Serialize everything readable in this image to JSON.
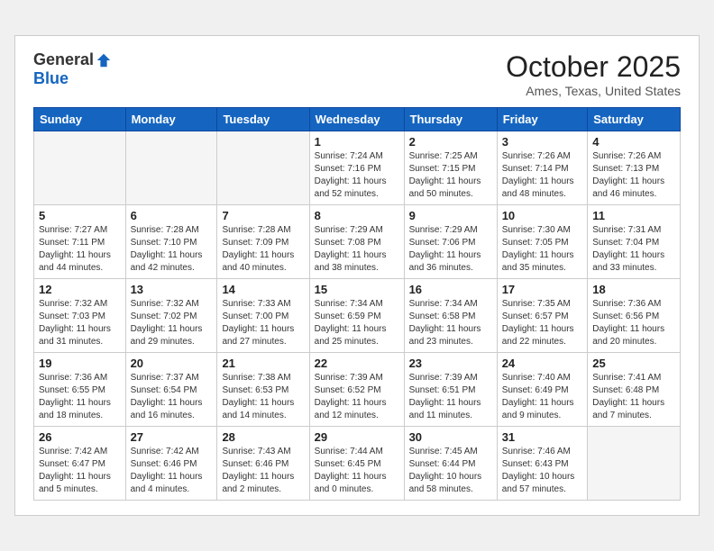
{
  "header": {
    "logo_general": "General",
    "logo_blue": "Blue",
    "month": "October 2025",
    "location": "Ames, Texas, United States"
  },
  "weekdays": [
    "Sunday",
    "Monday",
    "Tuesday",
    "Wednesday",
    "Thursday",
    "Friday",
    "Saturday"
  ],
  "weeks": [
    [
      {
        "day": "",
        "info": ""
      },
      {
        "day": "",
        "info": ""
      },
      {
        "day": "",
        "info": ""
      },
      {
        "day": "1",
        "info": "Sunrise: 7:24 AM\nSunset: 7:16 PM\nDaylight: 11 hours\nand 52 minutes."
      },
      {
        "day": "2",
        "info": "Sunrise: 7:25 AM\nSunset: 7:15 PM\nDaylight: 11 hours\nand 50 minutes."
      },
      {
        "day": "3",
        "info": "Sunrise: 7:26 AM\nSunset: 7:14 PM\nDaylight: 11 hours\nand 48 minutes."
      },
      {
        "day": "4",
        "info": "Sunrise: 7:26 AM\nSunset: 7:13 PM\nDaylight: 11 hours\nand 46 minutes."
      }
    ],
    [
      {
        "day": "5",
        "info": "Sunrise: 7:27 AM\nSunset: 7:11 PM\nDaylight: 11 hours\nand 44 minutes."
      },
      {
        "day": "6",
        "info": "Sunrise: 7:28 AM\nSunset: 7:10 PM\nDaylight: 11 hours\nand 42 minutes."
      },
      {
        "day": "7",
        "info": "Sunrise: 7:28 AM\nSunset: 7:09 PM\nDaylight: 11 hours\nand 40 minutes."
      },
      {
        "day": "8",
        "info": "Sunrise: 7:29 AM\nSunset: 7:08 PM\nDaylight: 11 hours\nand 38 minutes."
      },
      {
        "day": "9",
        "info": "Sunrise: 7:29 AM\nSunset: 7:06 PM\nDaylight: 11 hours\nand 36 minutes."
      },
      {
        "day": "10",
        "info": "Sunrise: 7:30 AM\nSunset: 7:05 PM\nDaylight: 11 hours\nand 35 minutes."
      },
      {
        "day": "11",
        "info": "Sunrise: 7:31 AM\nSunset: 7:04 PM\nDaylight: 11 hours\nand 33 minutes."
      }
    ],
    [
      {
        "day": "12",
        "info": "Sunrise: 7:32 AM\nSunset: 7:03 PM\nDaylight: 11 hours\nand 31 minutes."
      },
      {
        "day": "13",
        "info": "Sunrise: 7:32 AM\nSunset: 7:02 PM\nDaylight: 11 hours\nand 29 minutes."
      },
      {
        "day": "14",
        "info": "Sunrise: 7:33 AM\nSunset: 7:00 PM\nDaylight: 11 hours\nand 27 minutes."
      },
      {
        "day": "15",
        "info": "Sunrise: 7:34 AM\nSunset: 6:59 PM\nDaylight: 11 hours\nand 25 minutes."
      },
      {
        "day": "16",
        "info": "Sunrise: 7:34 AM\nSunset: 6:58 PM\nDaylight: 11 hours\nand 23 minutes."
      },
      {
        "day": "17",
        "info": "Sunrise: 7:35 AM\nSunset: 6:57 PM\nDaylight: 11 hours\nand 22 minutes."
      },
      {
        "day": "18",
        "info": "Sunrise: 7:36 AM\nSunset: 6:56 PM\nDaylight: 11 hours\nand 20 minutes."
      }
    ],
    [
      {
        "day": "19",
        "info": "Sunrise: 7:36 AM\nSunset: 6:55 PM\nDaylight: 11 hours\nand 18 minutes."
      },
      {
        "day": "20",
        "info": "Sunrise: 7:37 AM\nSunset: 6:54 PM\nDaylight: 11 hours\nand 16 minutes."
      },
      {
        "day": "21",
        "info": "Sunrise: 7:38 AM\nSunset: 6:53 PM\nDaylight: 11 hours\nand 14 minutes."
      },
      {
        "day": "22",
        "info": "Sunrise: 7:39 AM\nSunset: 6:52 PM\nDaylight: 11 hours\nand 12 minutes."
      },
      {
        "day": "23",
        "info": "Sunrise: 7:39 AM\nSunset: 6:51 PM\nDaylight: 11 hours\nand 11 minutes."
      },
      {
        "day": "24",
        "info": "Sunrise: 7:40 AM\nSunset: 6:49 PM\nDaylight: 11 hours\nand 9 minutes."
      },
      {
        "day": "25",
        "info": "Sunrise: 7:41 AM\nSunset: 6:48 PM\nDaylight: 11 hours\nand 7 minutes."
      }
    ],
    [
      {
        "day": "26",
        "info": "Sunrise: 7:42 AM\nSunset: 6:47 PM\nDaylight: 11 hours\nand 5 minutes."
      },
      {
        "day": "27",
        "info": "Sunrise: 7:42 AM\nSunset: 6:46 PM\nDaylight: 11 hours\nand 4 minutes."
      },
      {
        "day": "28",
        "info": "Sunrise: 7:43 AM\nSunset: 6:46 PM\nDaylight: 11 hours\nand 2 minutes."
      },
      {
        "day": "29",
        "info": "Sunrise: 7:44 AM\nSunset: 6:45 PM\nDaylight: 11 hours\nand 0 minutes."
      },
      {
        "day": "30",
        "info": "Sunrise: 7:45 AM\nSunset: 6:44 PM\nDaylight: 10 hours\nand 58 minutes."
      },
      {
        "day": "31",
        "info": "Sunrise: 7:46 AM\nSunset: 6:43 PM\nDaylight: 10 hours\nand 57 minutes."
      },
      {
        "day": "",
        "info": ""
      }
    ]
  ]
}
